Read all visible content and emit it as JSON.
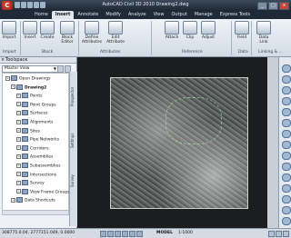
{
  "window": {
    "title": "AutoCAD Civil 3D 2010    Drawing2.dwg",
    "app_button": "C",
    "controls": [
      "_",
      "□",
      "x"
    ]
  },
  "ribbon_tabs": [
    "Home",
    "Insert",
    "Annotate",
    "Modify",
    "Analyze",
    "View",
    "Output",
    "Manage",
    "Express Tools"
  ],
  "active_tab": "Insert",
  "ribbon": {
    "buttons": [
      {
        "label": "Import"
      },
      {
        "label": "Insert"
      },
      {
        "label": "Create"
      },
      {
        "label": "Block Editor"
      },
      {
        "label": "Define Attributes"
      },
      {
        "label": "Edit Attribute"
      },
      {
        "label": "Attach"
      },
      {
        "label": "Clip"
      },
      {
        "label": "Adjust"
      },
      {
        "label": "Field"
      },
      {
        "label": "Data Link"
      }
    ],
    "panels": [
      "Import",
      "Block",
      "Attributes",
      "Reference",
      "Data",
      "Linking & ..."
    ]
  },
  "palette": {
    "title": "Toolspace",
    "view_select": "Master View",
    "side_tabs": [
      "Prospector",
      "Settings",
      "Survey"
    ],
    "tree": [
      {
        "label": "Open Drawings",
        "level": 0,
        "bold": false
      },
      {
        "label": "Drawing2",
        "level": 1,
        "bold": true
      },
      {
        "label": "Points",
        "level": 2,
        "bold": false
      },
      {
        "label": "Point Groups",
        "level": 2,
        "bold": false
      },
      {
        "label": "Surfaces",
        "level": 2,
        "bold": false
      },
      {
        "label": "Alignments",
        "level": 2,
        "bold": false
      },
      {
        "label": "Sites",
        "level": 2,
        "bold": false
      },
      {
        "label": "Pipe Networks",
        "level": 2,
        "bold": false
      },
      {
        "label": "Corridors",
        "level": 2,
        "bold": false
      },
      {
        "label": "Assemblies",
        "level": 2,
        "bold": false
      },
      {
        "label": "Subassemblies",
        "level": 2,
        "bold": false
      },
      {
        "label": "Intersections",
        "level": 2,
        "bold": false
      },
      {
        "label": "Survey",
        "level": 2,
        "bold": false
      },
      {
        "label": "View Frame Groups",
        "level": 2,
        "bold": false
      },
      {
        "label": "Data Shortcuts",
        "level": 1,
        "bold": false
      }
    ]
  },
  "status": {
    "coordinates": "308775.0.04, 2777151.049, 0.0000",
    "model": "MODEL",
    "scale": "1:1000"
  }
}
